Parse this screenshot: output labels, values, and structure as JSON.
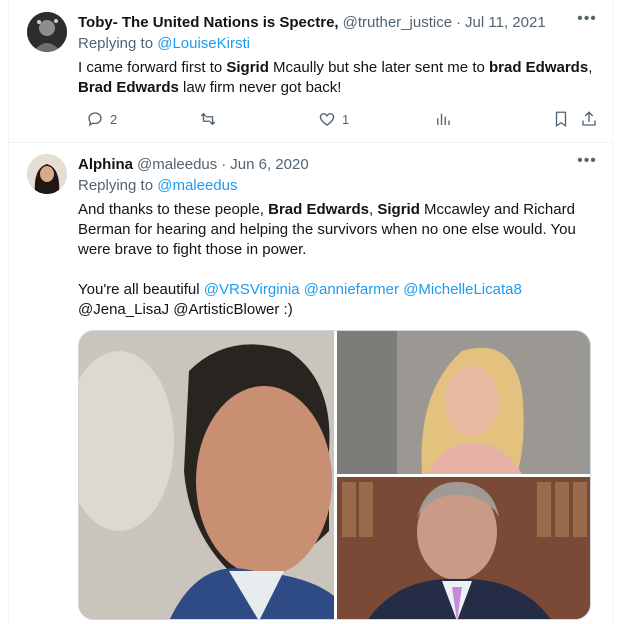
{
  "tweets": [
    {
      "name": "Toby- The United Nations is Spectre,",
      "handle": "@truther_justice",
      "date": "Jul 11, 2021",
      "reply_prefix": "Replying to ",
      "reply_to": "@LouiseKirsti",
      "text": {
        "p1": "I came forward first to ",
        "b1": "Sigrid",
        "p2": " Mcaully but she later sent me to ",
        "b2": "brad Edwards",
        "p3": ", ",
        "b3": "Brad Edwards",
        "p4": " law firm never got back!"
      },
      "actions": {
        "replies": "2",
        "retweets": "",
        "likes": "1"
      }
    },
    {
      "name": "Alphina",
      "handle": "@maleedus",
      "date": "Jun 6, 2020",
      "reply_prefix": "Replying to ",
      "reply_to": "@maleedus",
      "text": {
        "p1": "And thanks to these people, ",
        "b1": "Brad Edwards",
        "p2": ", ",
        "b2": "Sigrid",
        "p3": " Mccawley and Richard Berman for hearing and helping the survivors when no one else would. You were brave to fight those in power.",
        "p4": "You're all beautiful ",
        "m1": "@VRSVirginia",
        "m2": "@anniefarmer",
        "m3": "@MichelleLicata8",
        "p5": "@Jena_LisaJ @ArtisticBlower :)"
      }
    }
  ],
  "icons": {
    "more": "more-horizontal-icon",
    "reply": "reply-icon",
    "retweet": "retweet-icon",
    "like": "heart-icon",
    "views": "views-icon",
    "bookmark": "bookmark-icon",
    "share": "share-icon"
  },
  "colors": {
    "link": "#1d9bf0",
    "secondary": "#536471",
    "text": "#0f1419"
  }
}
